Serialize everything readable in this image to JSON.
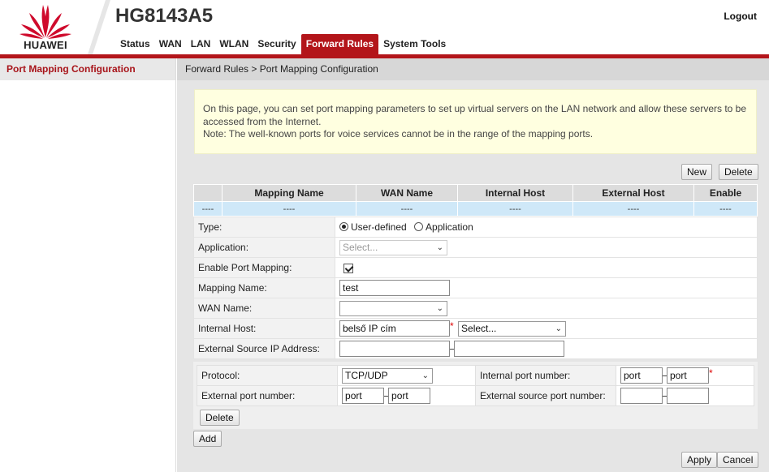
{
  "brand": {
    "logo_text": "HUAWEI",
    "color": "#cf0a2c"
  },
  "header": {
    "model": "HG8143A5",
    "logout": "Logout"
  },
  "nav": [
    {
      "label": "Status",
      "active": false
    },
    {
      "label": "WAN",
      "active": false
    },
    {
      "label": "LAN",
      "active": false
    },
    {
      "label": "WLAN",
      "active": false
    },
    {
      "label": "Security",
      "active": false
    },
    {
      "label": "Forward Rules",
      "active": true
    },
    {
      "label": "System Tools",
      "active": false
    }
  ],
  "sidebar": {
    "items": [
      {
        "label": "Port Mapping Configuration",
        "active": true
      }
    ]
  },
  "breadcrumb": "Forward Rules > Port Mapping Configuration",
  "note": {
    "line1": "On this page, you can set port mapping parameters to set up virtual servers on the LAN network and allow these servers to be accessed from the Internet.",
    "line2": "Note: The well-known ports for voice services cannot be in the range of the mapping ports."
  },
  "toolbar": {
    "new_label": "New",
    "delete_label": "Delete"
  },
  "table": {
    "headers": [
      "",
      "Mapping Name",
      "WAN Name",
      "Internal Host",
      "External Host",
      "Enable"
    ],
    "rows": [
      [
        "----",
        "----",
        "----",
        "----",
        "----",
        "----"
      ]
    ]
  },
  "form": {
    "type_label": "Type:",
    "type_opt_user": "User-defined",
    "type_opt_app": "Application",
    "application_label": "Application:",
    "application_value": "Select...",
    "enable_label": "Enable Port Mapping:",
    "mapping_name_label": "Mapping Name:",
    "mapping_name_value": "test",
    "wan_name_label": "WAN Name:",
    "wan_name_value": "",
    "internal_host_label": "Internal Host:",
    "internal_host_value": "belső IP cím",
    "internal_host_select": "Select...",
    "ext_source_label": "External Source IP Address:",
    "ext_source_start": "",
    "ext_source_end": "",
    "required_mark": "*"
  },
  "ports": {
    "protocol_label": "Protocol:",
    "protocol_value": "TCP/UDP",
    "internal_port_label": "Internal port number:",
    "internal_port_start": "port",
    "internal_port_end": "port",
    "external_port_label": "External port number:",
    "external_port_start": "port",
    "external_port_end": "port",
    "ext_source_port_label": "External source port number:",
    "ext_source_port_start": "",
    "ext_source_port_end": "",
    "delete_label": "Delete"
  },
  "actions": {
    "add_label": "Add",
    "apply_label": "Apply",
    "cancel_label": "Cancel"
  }
}
